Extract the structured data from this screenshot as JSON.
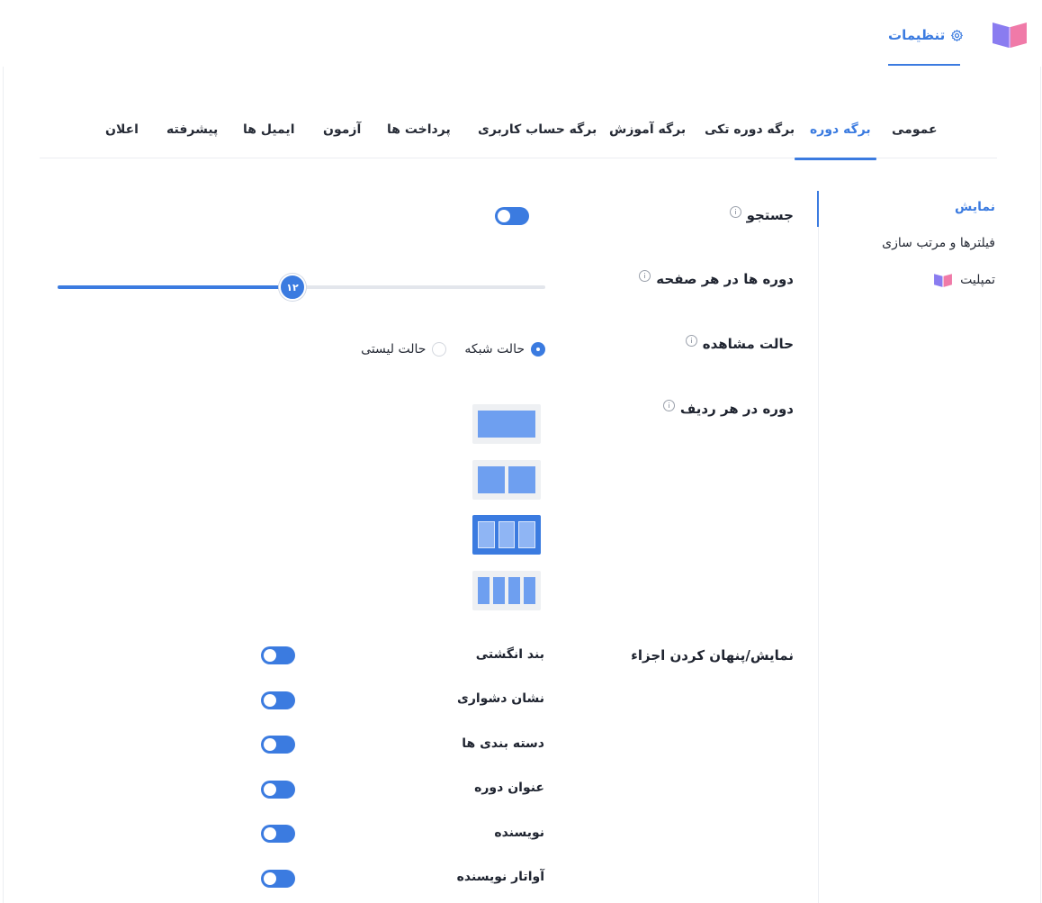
{
  "header": {
    "settings_label": "تنظیمات"
  },
  "tabs": [
    {
      "label": "عمومی",
      "active": false
    },
    {
      "label": "برگه دوره",
      "active": true
    },
    {
      "label": "برگه دوره تکی",
      "active": false
    },
    {
      "label": "برگه آموزش",
      "active": false
    },
    {
      "label": "برگه حساب کاربری",
      "active": false
    },
    {
      "label": "پرداخت ها",
      "active": false
    },
    {
      "label": "آزمون",
      "active": false
    },
    {
      "label": "ایمیل ها",
      "active": false
    },
    {
      "label": "پیشرفته",
      "active": false
    },
    {
      "label": "اعلان",
      "active": false
    }
  ],
  "sidebar": {
    "items": [
      {
        "label": "نمایش",
        "active": true
      },
      {
        "label": "فیلترها و مرتب سازی",
        "active": false
      },
      {
        "label": "تمپلیت",
        "active": false
      }
    ]
  },
  "settings": {
    "search": {
      "label": "جستجو",
      "enabled": true
    },
    "per_page": {
      "label": "دوره ها در هر صفحه",
      "value": "۱۲",
      "fraction": 0.477
    },
    "view_mode": {
      "label": "حالت مشاهده",
      "options": [
        {
          "label": "حالت شبکه",
          "selected": true
        },
        {
          "label": "حالت لیستی",
          "selected": false
        }
      ]
    },
    "per_row": {
      "label": "دوره در هر ردیف",
      "options": [
        1,
        2,
        3,
        4
      ],
      "selected": 3
    },
    "elements": {
      "label": "نمایش/پنهان کردن اجزاء",
      "items": [
        {
          "label": "بند انگشتی",
          "enabled": true
        },
        {
          "label": "نشان دشواری",
          "enabled": true
        },
        {
          "label": "دسته بندی ها",
          "enabled": true
        },
        {
          "label": "عنوان دوره",
          "enabled": true
        },
        {
          "label": "نویسنده",
          "enabled": true
        },
        {
          "label": "آواتار نویسنده",
          "enabled": true
        }
      ]
    }
  },
  "colors": {
    "accent": "#3b7be0",
    "logo_left": "#8a7cf0",
    "logo_right": "#f07aa8"
  }
}
